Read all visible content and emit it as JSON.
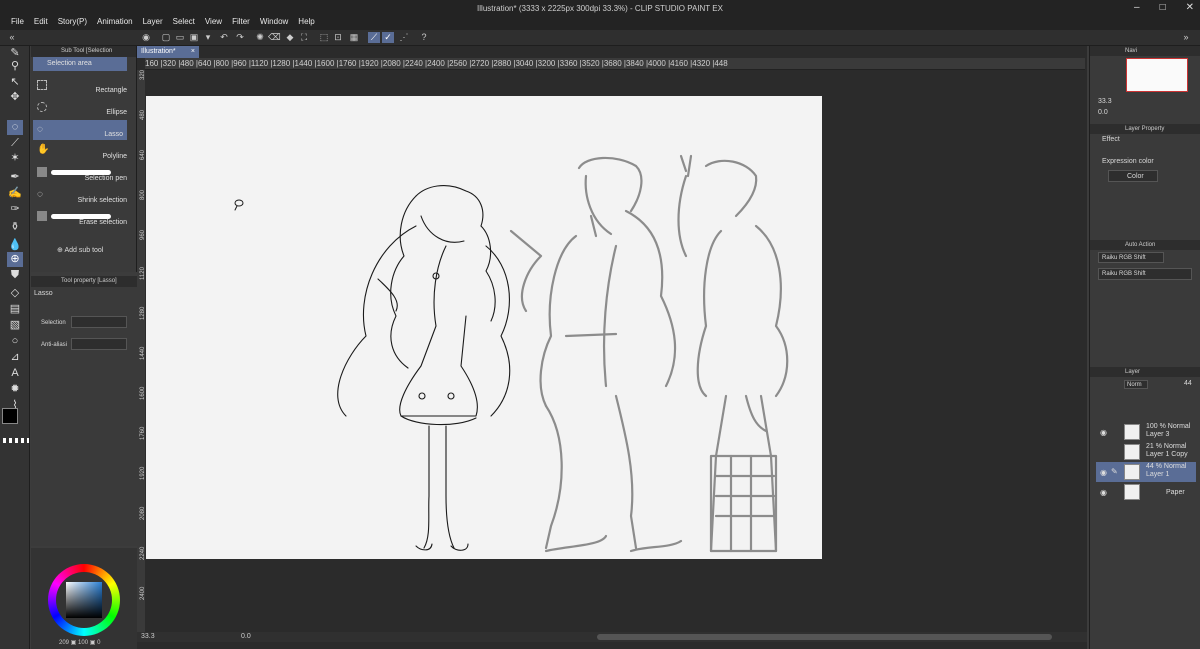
{
  "window": {
    "title": "Illustration* (3333 x 2225px 300dpi 33.3%)  - CLIP STUDIO PAINT EX",
    "menu": [
      "File",
      "Edit",
      "Story(P)",
      "Animation",
      "Layer",
      "Select",
      "View",
      "Filter",
      "Window",
      "Help"
    ],
    "controls": [
      "–",
      "□",
      "✕"
    ]
  },
  "subtool": {
    "header": "Sub Tool [Selection",
    "items": [
      {
        "label": "Selection area"
      },
      {
        "label": "Rectangle"
      },
      {
        "label": "Ellipse"
      },
      {
        "label": "Lasso"
      },
      {
        "label": "Polyline"
      },
      {
        "label": "Selection pen"
      },
      {
        "label": "Shrink selection"
      },
      {
        "label": "Erase selection"
      }
    ],
    "add_label": "Add sub tool"
  },
  "toolprop": {
    "header": "Tool property [Lasso]",
    "tool_name": "Lasso",
    "selection_label": "Selection",
    "antialias_label": "Anti-aliasi"
  },
  "color": {
    "fg": "#000000",
    "bg": "#ffffff",
    "r": "209",
    "g": "100",
    "b": "0"
  },
  "canvas": {
    "tab": "Illustration*",
    "ruler_h": "160 |320 |480 |640 |800 |960 |1120 |1280 |1440 |1600 |1760 |1920 |2080 |2240 |2400 |2560 |2720 |2880 |3040 |3200 |3360 |3520 |3680 |3840 |4000 |4160 |4320 |448",
    "ruler_v": [
      "320",
      "480",
      "640",
      "800",
      "960",
      "1120",
      "1280",
      "1440",
      "1600",
      "1760",
      "1920",
      "2080",
      "2240",
      "2400"
    ],
    "zoom": "33.3",
    "rotation": "0.0"
  },
  "right": {
    "nav_header": "Navi",
    "nav_zoom": "33.3",
    "nav_rot": "0.0",
    "layerprop_header": "Layer Property",
    "effect_label": "Effect",
    "expression_label": "Expression color",
    "expression_value": "Color",
    "autoaction_header": "Auto Action",
    "autoaction_set": "Raiku RGB Shift",
    "autoaction_item": "Raiku RGB Shift",
    "layer_header": "Layer",
    "blend": "Norm",
    "opacity": "44",
    "layers": [
      {
        "line1": "100 % Normal",
        "line2": "Layer 3"
      },
      {
        "line1": "21 % Normal",
        "line2": "Layer 1 Copy"
      },
      {
        "line1": "44 % Normal",
        "line2": "Layer 1"
      },
      {
        "line1": "",
        "line2": "Paper"
      }
    ]
  }
}
